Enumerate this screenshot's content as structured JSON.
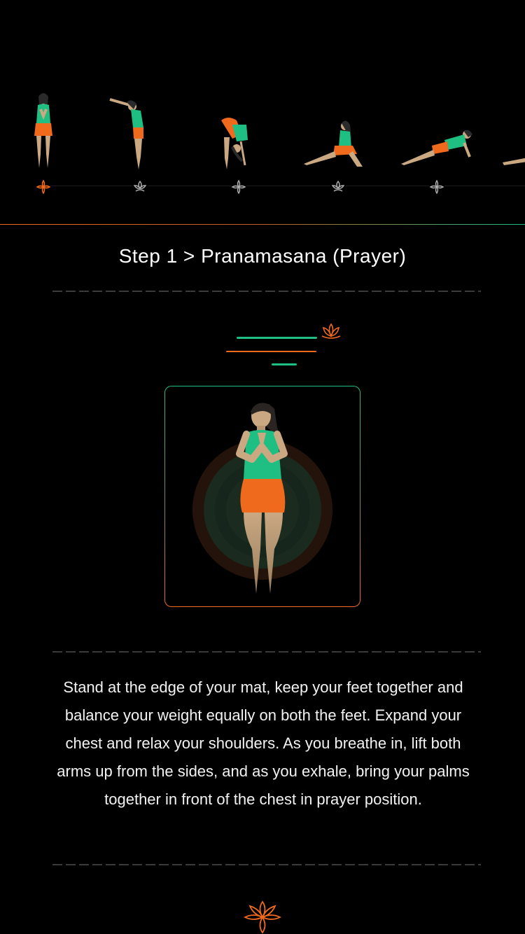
{
  "carousel": {
    "poses": [
      {
        "name": "prayer",
        "active": true
      },
      {
        "name": "raised-arms",
        "active": false
      },
      {
        "name": "hand-to-foot",
        "active": false
      },
      {
        "name": "equestrian",
        "active": false
      },
      {
        "name": "stick",
        "active": false
      },
      {
        "name": "salute",
        "active": false
      }
    ]
  },
  "step": {
    "title": "Step 1 > Pranamasana (Prayer)"
  },
  "description": "Stand at the edge of your mat, keep your feet together and balance your weight equally on both the feet. Expand your chest and relax your shoulders. As you breathe in, lift both arms up from the sides, and as you exhale, bring your palms together in front of the chest in prayer position.",
  "colors": {
    "background": "#000000",
    "accent_orange": "#f06a1e",
    "accent_green": "#1fbf83",
    "skin": "#c9a882",
    "text": "#ffffff"
  },
  "icons": {
    "marker_active": "lotus-orange-icon",
    "marker_inactive": "lotus-outline-icon",
    "header_decoration": "lotus-icon",
    "footer_decoration": "lotus-flower-icon"
  }
}
